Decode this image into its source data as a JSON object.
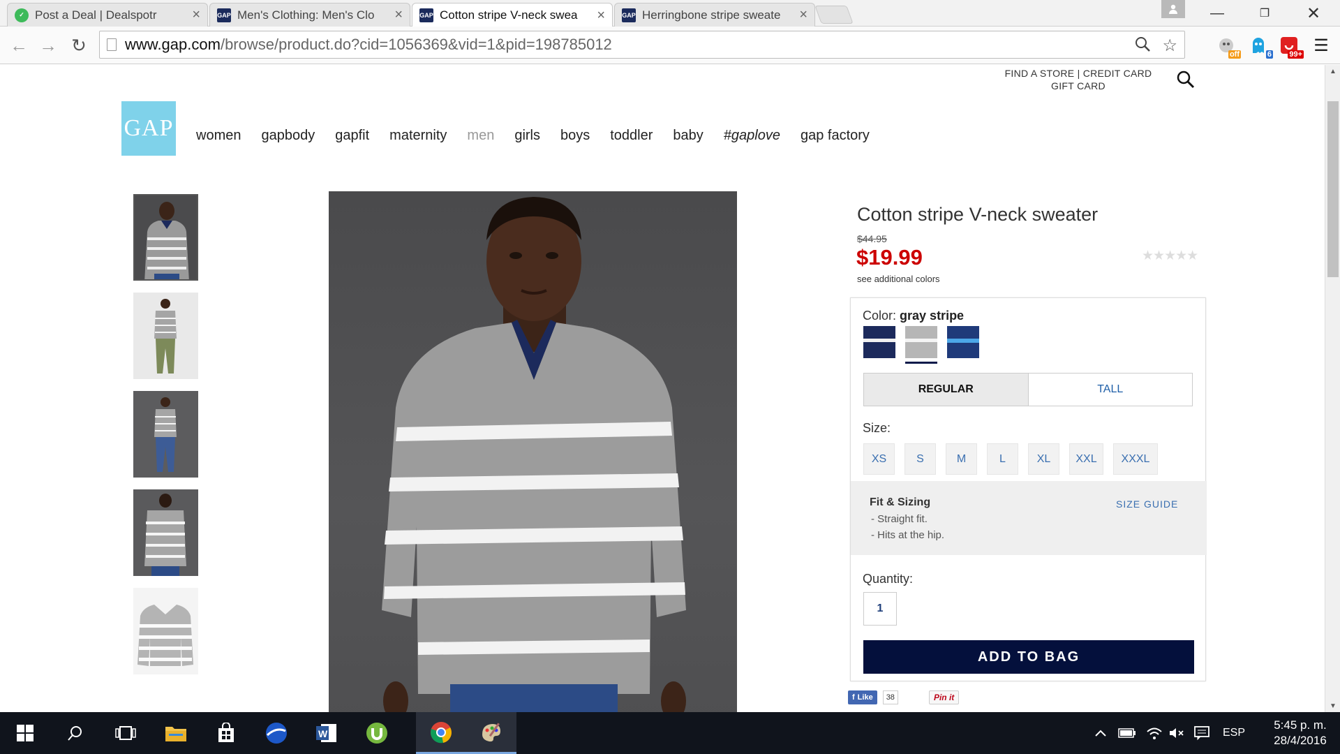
{
  "browser": {
    "tabs": [
      {
        "title": "Post a Deal | Dealspotr",
        "favicon": "dealspotr-icon",
        "active": false
      },
      {
        "title": "Men's Clothing: Men's Clo",
        "favicon": "gap-icon",
        "active": false
      },
      {
        "title": "Cotton stripe V-neck swea",
        "favicon": "gap-icon",
        "active": true
      },
      {
        "title": "Herringbone stripe sweate",
        "favicon": "gap-icon",
        "active": false
      }
    ],
    "url_host": "www.gap.com",
    "url_path": "/browse/product.do?cid=1056369&vid=1&pid=198785012",
    "extension_badges": {
      "honey": "off",
      "ghostery": "6",
      "red": "99+"
    }
  },
  "utility": {
    "find_store": "FIND A STORE",
    "separator": "|",
    "credit_card": "CREDIT CARD",
    "gift_card": "GIFT CARD"
  },
  "logo_text": "GAP",
  "nav": [
    "women",
    "gapbody",
    "gapfit",
    "maternity",
    "men",
    "girls",
    "boys",
    "toddler",
    "baby",
    "#gaplove",
    "gap factory"
  ],
  "product": {
    "title": "Cotton stripe V-neck sweater",
    "original_price": "$44.95",
    "sale_price": "$19.99",
    "stars": "★★★★★",
    "additional_colors": "see additional colors",
    "color_label": "Color:",
    "color_value": "gray stripe",
    "swatches": [
      "navy stripe",
      "gray stripe",
      "blue stripe"
    ],
    "fit_options": [
      "REGULAR",
      "TALL"
    ],
    "size_label": "Size:",
    "sizes": [
      "XS",
      "S",
      "M",
      "L",
      "XL",
      "XXL",
      "XXXL"
    ],
    "fit_title": "Fit & Sizing",
    "fit_lines": [
      "- Straight fit.",
      "- Hits at the hip."
    ],
    "size_guide": "SIZE GUIDE",
    "quantity_label": "Quantity:",
    "quantity": "1",
    "add_to_bag": "ADD TO BAG"
  },
  "social": {
    "like": "Like",
    "like_count": "38",
    "pin": "Pin it"
  },
  "taskbar": {
    "language": "ESP",
    "time": "5:45 p. m.",
    "date": "28/4/2016"
  },
  "colors": {
    "sale_red": "#cc0000",
    "add_button": "#04103c",
    "logo_bg": "#7fd2ea",
    "link_blue": "#3a6fb0"
  }
}
